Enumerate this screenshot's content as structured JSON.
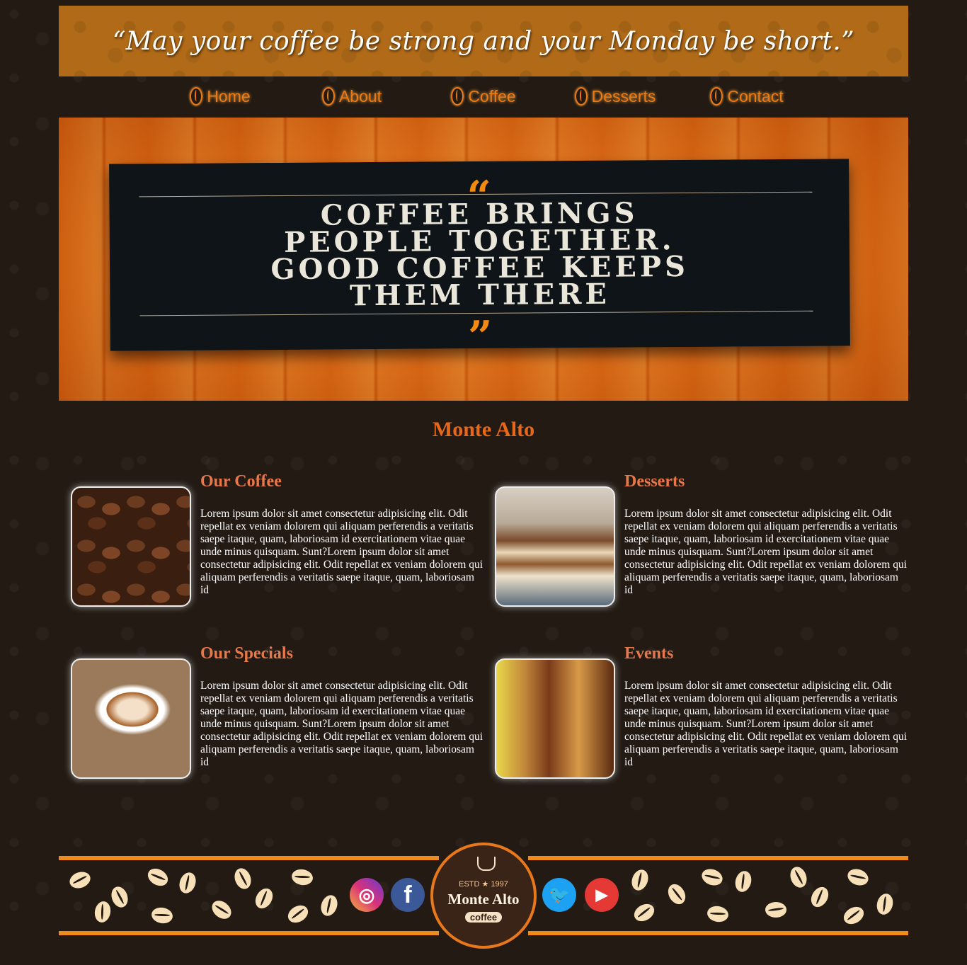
{
  "header": {
    "quote": "“May your coffee be strong and your Monday be short.”"
  },
  "nav": [
    {
      "label": "Home"
    },
    {
      "label": "About"
    },
    {
      "label": "Coffee"
    },
    {
      "label": "Desserts"
    },
    {
      "label": "Contact"
    }
  ],
  "hero": {
    "open_quote": "“",
    "close_quote": "”",
    "sign_text": "COFFEE BRINGS\nPEOPLE TOGETHER.\nGOOD COFFEE KEEPS\nTHEM THERE"
  },
  "brand": {
    "title": "Monte Alto"
  },
  "cards": [
    {
      "title": "Our Coffee",
      "body": "Lorem ipsum dolor sit amet consectetur adipisicing elit. Odit repellat ex veniam dolorem qui aliquam perferendis a veritatis saepe itaque, quam, laboriosam id exercitationem vitae quae unde minus quisquam. Sunt?Lorem ipsum dolor sit amet consectetur adipisicing elit. Odit repellat ex veniam dolorem qui aliquam perferendis a veritatis saepe itaque, quam, laboriosam id"
    },
    {
      "title": "Desserts",
      "body": "Lorem ipsum dolor sit amet consectetur adipisicing elit. Odit repellat ex veniam dolorem qui aliquam perferendis a veritatis saepe itaque, quam, laboriosam id exercitationem vitae quae unde minus quisquam. Sunt?Lorem ipsum dolor sit amet consectetur adipisicing elit. Odit repellat ex veniam dolorem qui aliquam perferendis a veritatis saepe itaque, quam, laboriosam id"
    },
    {
      "title": "Our Specials",
      "body": "Lorem ipsum dolor sit amet consectetur adipisicing elit. Odit repellat ex veniam dolorem qui aliquam perferendis a veritatis saepe itaque, quam, laboriosam id exercitationem vitae quae unde minus quisquam. Sunt?Lorem ipsum dolor sit amet consectetur adipisicing elit. Odit repellat ex veniam dolorem qui aliquam perferendis a veritatis saepe itaque, quam, laboriosam id"
    },
    {
      "title": "Events",
      "body": "Lorem ipsum dolor sit amet consectetur adipisicing elit. Odit repellat ex veniam dolorem qui aliquam perferendis a veritatis saepe itaque, quam, laboriosam id exercitationem vitae quae unde minus quisquam. Sunt?Lorem ipsum dolor sit amet consectetur adipisicing elit. Odit repellat ex veniam dolorem qui aliquam perferendis a veritatis saepe itaque, quam, laboriosam id"
    }
  ],
  "footer": {
    "social": [
      {
        "name": "instagram-icon",
        "glyph": "◎",
        "color": "#d9327a"
      },
      {
        "name": "facebook-icon",
        "glyph": "f",
        "color": "#3b5998"
      },
      {
        "name": "twitter-icon",
        "glyph": "🐦",
        "color": "#1da1f2"
      },
      {
        "name": "youtube-icon",
        "glyph": "▶",
        "color": "#e53935"
      }
    ],
    "logo": {
      "estd": "ESTD  ★  1997",
      "name": "Monte Alto",
      "sub": "coffee"
    }
  },
  "colors": {
    "accent": "#f08a1a",
    "title": "#e8681a",
    "card_title": "#e8784a",
    "background": "#221a13"
  }
}
